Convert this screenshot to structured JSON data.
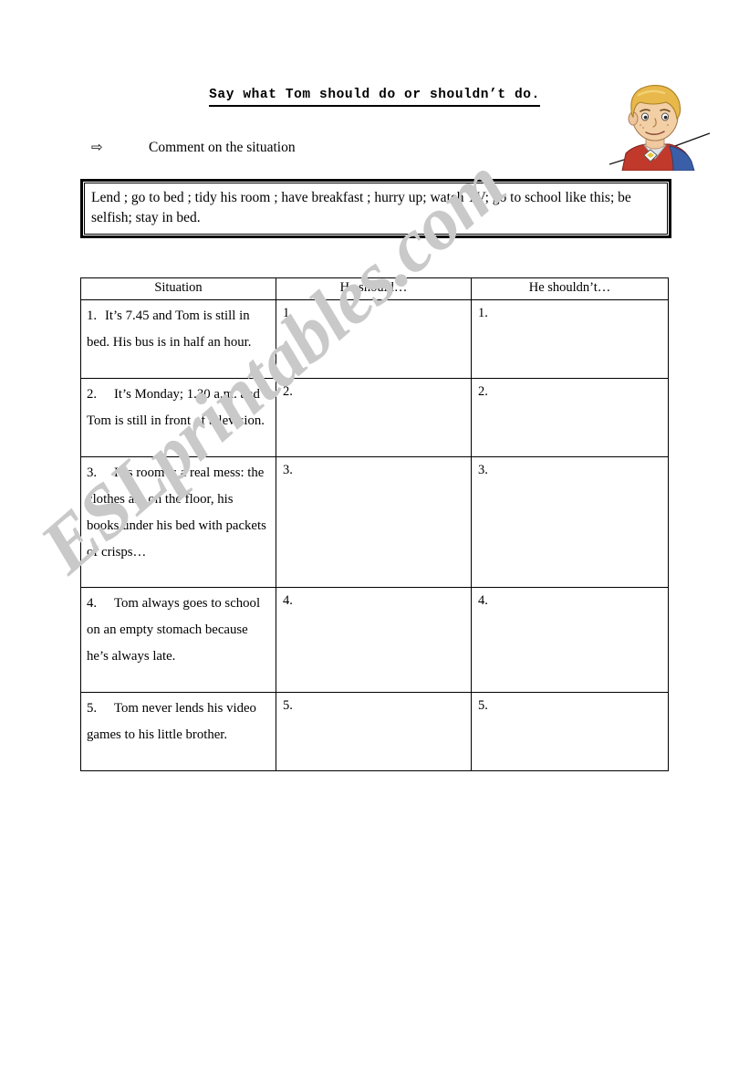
{
  "document": {
    "title": "Say what Tom should do or shouldn’t do.",
    "watermark": "ESLprintables.com"
  },
  "instruction": {
    "bullet_icon": "arrow-right-outline-icon",
    "bullet_glyph": "⇨",
    "text": "Comment on the situation"
  },
  "word_bank": {
    "text": "Lend ; go to bed ; tidy his room ; have breakfast ; hurry up; watch TV; go to school like this; be selfish; stay in bed."
  },
  "illustration": {
    "alt": "cartoon boy with blond hair holding a broom",
    "colors": {
      "hair": "#e8b84b",
      "skin": "#f0c9a0",
      "shirt_red": "#c0392b",
      "shirt_blue": "#3b5ea8",
      "outline": "#2b2b2b"
    }
  },
  "table": {
    "headers": [
      "Situation",
      "He should…",
      "He shouldn’t…"
    ],
    "rows": [
      {
        "number": "1.",
        "situation": "It’s 7.45 and Tom is still in bed. His bus is in half an hour.",
        "should": "1.",
        "shouldnt": "1."
      },
      {
        "number": "2.",
        "situation": "It’s  Monday; 1.30 a.m. and Tom is still in front of television.",
        "should": "2.",
        "shouldnt": "2."
      },
      {
        "number": "3.",
        "situation": "His room is a real mess: the clothes are on the floor, his books under his bed with packets of crisps…",
        "should": "3.",
        "shouldnt": "3."
      },
      {
        "number": "4.",
        "situation": "Tom always goes to school on an empty stomach because he’s always late.",
        "should": "4.",
        "shouldnt": "4."
      },
      {
        "number": "5.",
        "situation": "Tom never lends his video games to his little brother.",
        "should": "5.",
        "shouldnt": "5."
      }
    ]
  }
}
